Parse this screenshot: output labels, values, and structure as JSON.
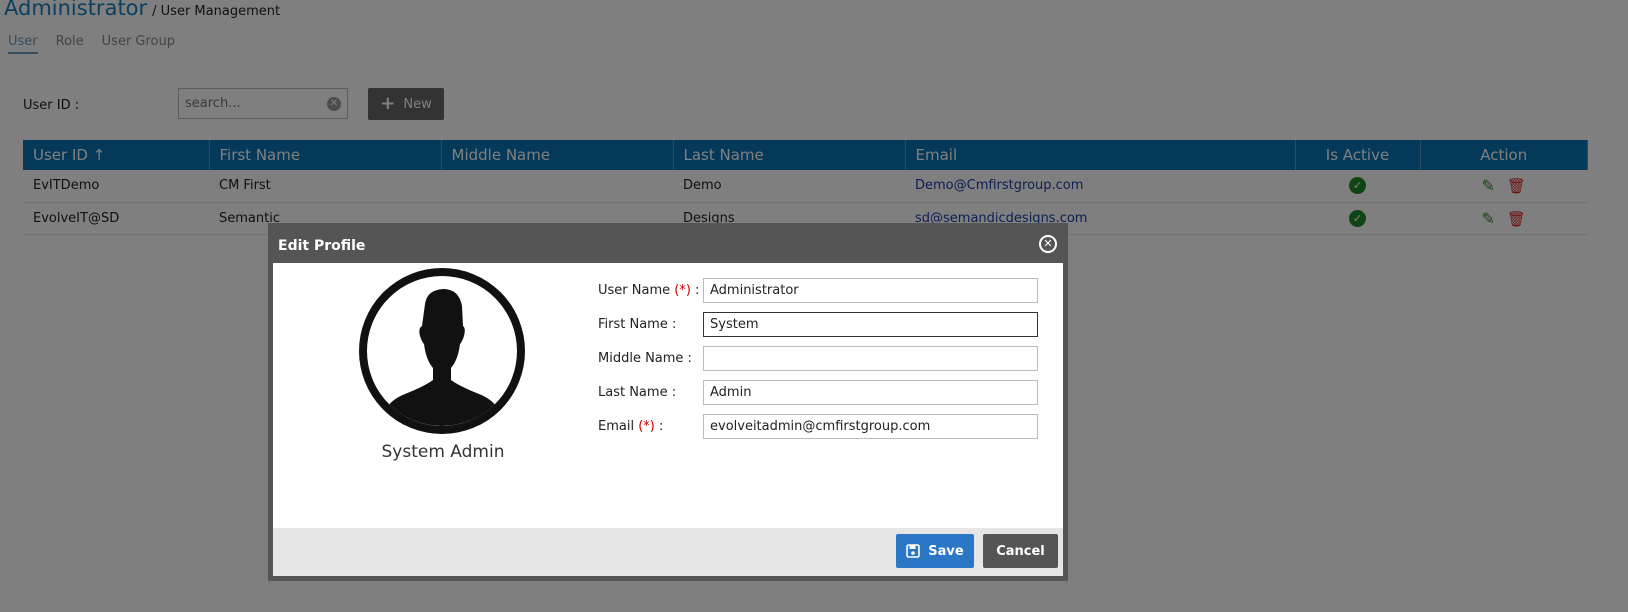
{
  "header": {
    "title": "Administrator",
    "breadcrumb": "/ User Management"
  },
  "tabs": [
    {
      "label": "User",
      "active": true
    },
    {
      "label": "Role",
      "active": false
    },
    {
      "label": "User Group",
      "active": false
    }
  ],
  "filter": {
    "label": "User ID :",
    "search_placeholder": "search...",
    "new_label": "New"
  },
  "table": {
    "columns": [
      "User ID ↑",
      "First Name",
      "Middle Name",
      "Last Name",
      "Email",
      "Is Active",
      "Action"
    ],
    "rows": [
      {
        "user_id": "EvITDemo",
        "first_name": "CM First",
        "middle_name": "",
        "last_name": "Demo",
        "email": "Demo@Cmfirstgroup.com",
        "active": true
      },
      {
        "user_id": "EvolveIT@SD",
        "first_name": "Semantic",
        "middle_name": "",
        "last_name": "Designs",
        "email": "sd@semandicdesigns.com",
        "active": true
      }
    ]
  },
  "dialog": {
    "title": "Edit Profile",
    "avatar_name": "System Admin",
    "fields": {
      "user_name": {
        "label": "User Name",
        "required": "(*)",
        "suffix": " :",
        "value": "Administrator"
      },
      "first_name": {
        "label": "First Name :",
        "value": "System"
      },
      "middle_name": {
        "label": "Middle Name :",
        "value": ""
      },
      "last_name": {
        "label": "Last Name :",
        "value": "Admin"
      },
      "email": {
        "label": "Email",
        "required": "(*)",
        "suffix": " :",
        "value": "evolveitadmin@cmfirstgroup.com"
      }
    },
    "save_label": "Save",
    "cancel_label": "Cancel"
  },
  "colors": {
    "brand": "#1a7fc0",
    "table_header": "#0872b2",
    "save": "#2b77c6",
    "active": "#1e8a2a",
    "delete": "#dd2222"
  }
}
